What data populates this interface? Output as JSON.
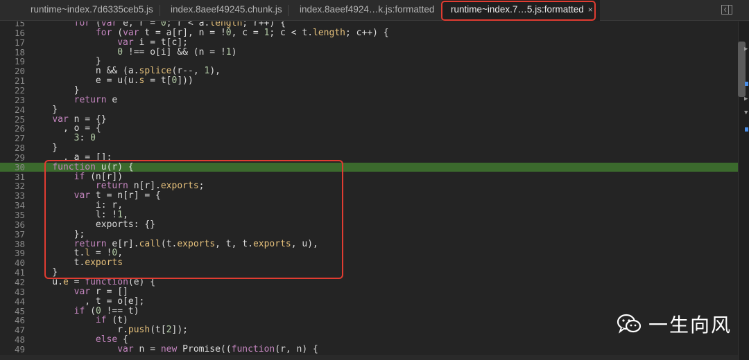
{
  "tabs": [
    {
      "label": "runtime~index.7d6335ceb5.js",
      "active": false
    },
    {
      "label": "index.8aeef49245.chunk.js",
      "active": false
    },
    {
      "label": "index.8aeef4924…k.js:formatted",
      "active": false
    },
    {
      "label": "runtime~index.7…5.js:formatted",
      "active": true,
      "close": "×"
    }
  ],
  "editor": {
    "highlighted_line": 30,
    "lines": [
      {
        "n": "15",
        "code": "        for (var e, r = 0; r < a.length; r++) {"
      },
      {
        "n": "16",
        "code": "            for (var t = a[r], n = !0, c = 1; c < t.length; c++) {"
      },
      {
        "n": "17",
        "code": "                var i = t[c];"
      },
      {
        "n": "18",
        "code": "                0 !== o[i] && (n = !1)"
      },
      {
        "n": "19",
        "code": "            }"
      },
      {
        "n": "20",
        "code": "            n && (a.splice(r--, 1),"
      },
      {
        "n": "21",
        "code": "            e = u(u.s = t[0]))"
      },
      {
        "n": "22",
        "code": "        }"
      },
      {
        "n": "23",
        "code": "        return e"
      },
      {
        "n": "24",
        "code": "    }"
      },
      {
        "n": "25",
        "code": "    var n = {}"
      },
      {
        "n": "26",
        "code": "      , o = {"
      },
      {
        "n": "27",
        "code": "        3: 0"
      },
      {
        "n": "28",
        "code": "    }"
      },
      {
        "n": "29",
        "code": "      , a = [];"
      },
      {
        "n": "30",
        "code": "    function u(r) {"
      },
      {
        "n": "31",
        "code": "        if (n[r])"
      },
      {
        "n": "32",
        "code": "            return n[r].exports;"
      },
      {
        "n": "33",
        "code": "        var t = n[r] = {"
      },
      {
        "n": "34",
        "code": "            i: r,"
      },
      {
        "n": "35",
        "code": "            l: !1,"
      },
      {
        "n": "36",
        "code": "            exports: {}"
      },
      {
        "n": "37",
        "code": "        };"
      },
      {
        "n": "38",
        "code": "        return e[r].call(t.exports, t, t.exports, u),"
      },
      {
        "n": "39",
        "code": "        t.l = !0,"
      },
      {
        "n": "40",
        "code": "        t.exports"
      },
      {
        "n": "41",
        "code": "    }"
      },
      {
        "n": "42",
        "code": "    u.e = function(e) {"
      },
      {
        "n": "43",
        "code": "        var r = []"
      },
      {
        "n": "44",
        "code": "          , t = o[e];"
      },
      {
        "n": "45",
        "code": "        if (0 !== t)"
      },
      {
        "n": "46",
        "code": "            if (t)"
      },
      {
        "n": "47",
        "code": "                r.push(t[2]);"
      },
      {
        "n": "48",
        "code": "            else {"
      },
      {
        "n": "49",
        "code": "                var n = new Promise((function(r, n) {"
      }
    ]
  },
  "watermark": {
    "text": "一生向风",
    "icon": "wechat-icon"
  },
  "colors": {
    "highlight": "#3b6a2d",
    "annotation": "#e03c31",
    "background": "#242424"
  }
}
